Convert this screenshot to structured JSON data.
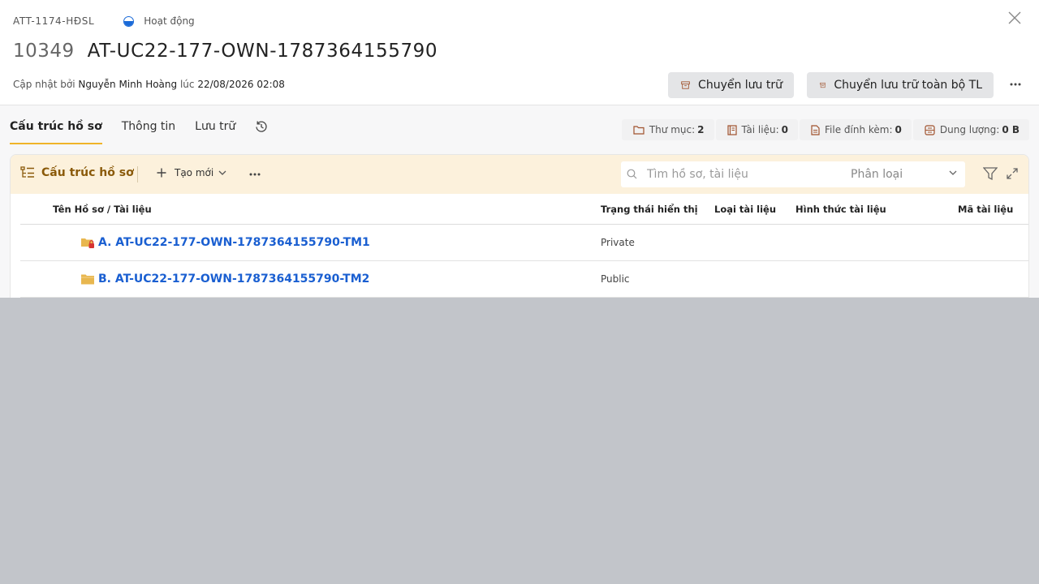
{
  "header": {
    "code": "ATT-1174-HĐSL",
    "status": "Hoạt động",
    "id": "10349",
    "name": "AT-UC22-177-OWN-1787364155790",
    "updated_by_label": "Cập nhật bởi",
    "updated_by": "Nguyễn Minh Hoàng",
    "at_label": "lúc",
    "updated_at": "22/08/2026 02:08"
  },
  "actions": {
    "archive": "Chuyển lưu trữ",
    "archive_all": "Chuyển lưu trữ toàn bộ TL"
  },
  "tabs": [
    {
      "label": "Cấu trúc hồ sơ",
      "active": true
    },
    {
      "label": "Thông tin",
      "active": false
    },
    {
      "label": "Lưu trữ",
      "active": false
    }
  ],
  "stats": {
    "folders_label": "Thư mục:",
    "folders": "2",
    "documents_label": "Tài liệu:",
    "documents": "0",
    "attachments_label": "File đính kèm:",
    "attachments": "0",
    "capacity_label": "Dung lượng:",
    "capacity": "0 B"
  },
  "toolbar": {
    "title": "Cấu trúc hồ sơ",
    "new_label": "Tạo mới",
    "search_placeholder": "Tìm hồ sơ, tài liệu",
    "classify_placeholder": "Phân loại"
  },
  "table": {
    "columns": [
      "Tên Hồ sơ / Tài liệu",
      "Trạng thái hiển thị",
      "Loại tài liệu",
      "Hình thức tài liệu",
      "Mã tài liệu"
    ],
    "rows": [
      {
        "name": "A. AT-UC22-177-OWN-1787364155790-TM1",
        "visibility": "Private",
        "icon": "locked-folder-icon"
      },
      {
        "name": "B. AT-UC22-177-OWN-1787364155790-TM2",
        "visibility": "Public",
        "icon": "folder-icon"
      }
    ]
  },
  "colors": {
    "accent": "#f0b429",
    "link": "#1a5fd1",
    "toolbar_bg": "#fcf1dc",
    "status_blue": "#1a6ad8",
    "overlay": "#c2c5ca"
  }
}
